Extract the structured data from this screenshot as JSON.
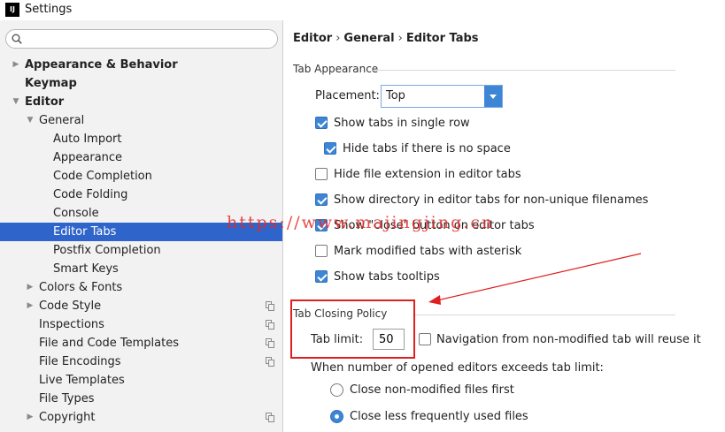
{
  "window": {
    "title": "Settings",
    "app_icon_text": "IJ"
  },
  "search": {
    "value": "",
    "placeholder": ""
  },
  "sidebar": {
    "items": [
      {
        "label": "Appearance & Behavior",
        "bold": true,
        "expanded": false,
        "has_arrow": true,
        "level": 0
      },
      {
        "label": "Keymap",
        "bold": true,
        "has_arrow": false,
        "level": 0
      },
      {
        "label": "Editor",
        "bold": true,
        "expanded": true,
        "has_arrow": true,
        "level": 0
      },
      {
        "label": "General",
        "expanded": true,
        "has_arrow": true,
        "level": 1
      },
      {
        "label": "Auto Import",
        "level": 2
      },
      {
        "label": "Appearance",
        "level": 2
      },
      {
        "label": "Code Completion",
        "level": 2
      },
      {
        "label": "Code Folding",
        "level": 2
      },
      {
        "label": "Console",
        "level": 2
      },
      {
        "label": "Editor Tabs",
        "level": 2,
        "selected": true
      },
      {
        "label": "Postfix Completion",
        "level": 2
      },
      {
        "label": "Smart Keys",
        "level": 2
      },
      {
        "label": "Colors & Fonts",
        "has_arrow": true,
        "expanded": false,
        "level": 1
      },
      {
        "label": "Code Style",
        "has_arrow": true,
        "expanded": false,
        "level": 1,
        "copy_icon": true
      },
      {
        "label": "Inspections",
        "level": 1,
        "copy_icon": true
      },
      {
        "label": "File and Code Templates",
        "level": 1,
        "copy_icon": true
      },
      {
        "label": "File Encodings",
        "level": 1,
        "copy_icon": true
      },
      {
        "label": "Live Templates",
        "level": 1
      },
      {
        "label": "File Types",
        "level": 1
      },
      {
        "label": "Copyright",
        "has_arrow": true,
        "expanded": false,
        "level": 1,
        "copy_icon": true
      }
    ]
  },
  "breadcrumb": {
    "parts": [
      "Editor",
      "General",
      "Editor Tabs"
    ],
    "separator": "›"
  },
  "tab_appearance": {
    "title": "Tab Appearance",
    "placement_label": "Placement:",
    "placement_value": "Top",
    "options": [
      {
        "label": "Show tabs in single row",
        "checked": true
      },
      {
        "label": "Hide tabs if there is no space",
        "checked": true
      },
      {
        "label": "Hide file extension in editor tabs",
        "checked": false
      },
      {
        "label": "Show directory in editor tabs for non-unique filenames",
        "checked": true
      },
      {
        "label": "Show \"close\" button on editor tabs",
        "checked": true
      },
      {
        "label": "Mark modified tabs with asterisk",
        "checked": false
      },
      {
        "label": "Show tabs tooltips",
        "checked": true
      }
    ]
  },
  "tab_closing": {
    "title": "Tab Closing Policy",
    "limit_label": "Tab limit:",
    "limit_value": "50",
    "navigation_label": "Navigation from non-modified tab will reuse it",
    "navigation_checked": false,
    "exceeds_label": "When number of opened editors exceeds tab limit:",
    "radio_options": [
      {
        "label": "Close non-modified files first",
        "checked": false
      },
      {
        "label": "Close less frequently used files",
        "checked": true
      }
    ]
  },
  "watermark": "https://www.majingjing.cn",
  "colors": {
    "selection": "#2f65ca",
    "accent": "#3d86d6",
    "annotation": "#e02020"
  }
}
